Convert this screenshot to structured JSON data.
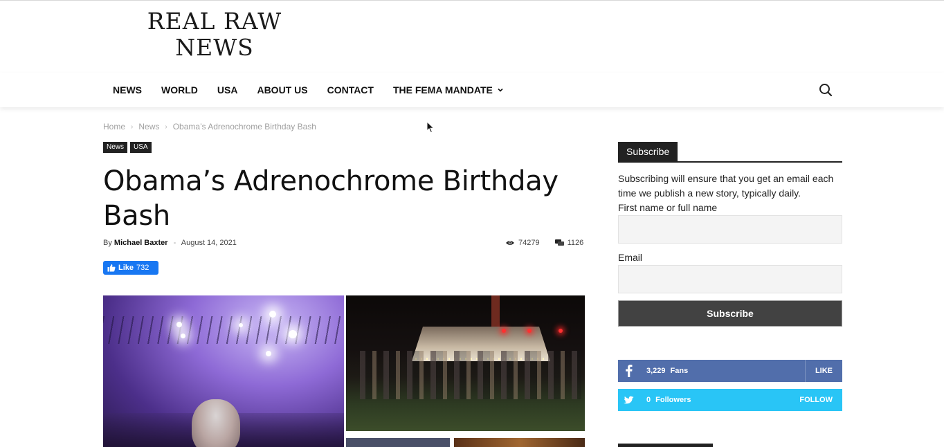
{
  "site": {
    "logo_line1": "REAL RAW",
    "logo_line2": "NEWS"
  },
  "nav": {
    "items": [
      {
        "label": "NEWS"
      },
      {
        "label": "WORLD"
      },
      {
        "label": "USA"
      },
      {
        "label": "ABOUT US"
      },
      {
        "label": "CONTACT"
      },
      {
        "label": "THE FEMA MANDATE",
        "has_dropdown": true
      }
    ],
    "search_icon": "search-icon"
  },
  "breadcrumb": {
    "items": [
      "Home",
      "News",
      "Obama’s Adrenochrome Birthday Bash"
    ],
    "separator": "›"
  },
  "article": {
    "tags": [
      "News",
      "USA"
    ],
    "title": "Obama’s Adrenochrome Birthday Bash",
    "by_label": "By",
    "author": "Michael Baxter",
    "date_dash": "-",
    "date": "August 14, 2021",
    "views": "74279",
    "comments": "1126",
    "fb_like_label": "Like",
    "fb_like_count": "732"
  },
  "sidebar": {
    "heading": "Subscribe",
    "description": "Subscribing will ensure that you get an email each time we publish a new story, typically daily.",
    "name_label": "First name or full name",
    "email_label": "Email",
    "button_label": "Subscribe",
    "social": {
      "facebook": {
        "count": "3,229",
        "label": "Fans",
        "action": "LIKE",
        "color": "#516eab"
      },
      "twitter": {
        "count": "0",
        "label": "Followers",
        "action": "FOLLOW",
        "color": "#29c5f6"
      }
    }
  },
  "colors": {
    "tag_bg": "#222222",
    "fb_like": "#1877f2",
    "subscribe_button": "#424242"
  }
}
